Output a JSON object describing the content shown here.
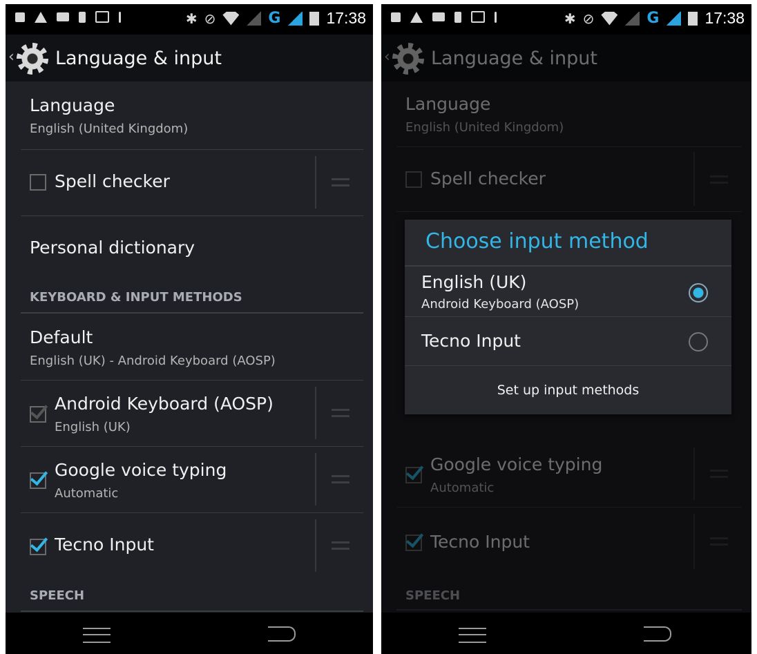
{
  "status_bar": {
    "time": "17:38",
    "network": "G"
  },
  "action_bar": {
    "title": "Language & input"
  },
  "settings": {
    "language_title": "Language",
    "language_value": "English (United Kingdom)",
    "spell_checker": "Spell checker",
    "personal_dictionary": "Personal dictionary",
    "keyboard_section": "KEYBOARD & INPUT METHODS",
    "default_title": "Default",
    "default_value": "English (UK) - Android Keyboard (AOSP)",
    "aosp_title": "Android Keyboard (AOSP)",
    "aosp_sub": "English (UK)",
    "google_voice_title": "Google voice typing",
    "google_voice_sub": "Automatic",
    "tecno_title": "Tecno Input",
    "speech_section": "SPEECH"
  },
  "dialog": {
    "title": "Choose input method",
    "options": [
      {
        "label": "English (UK)",
        "sub": "Android Keyboard (AOSP)",
        "selected": true
      },
      {
        "label": "Tecno Input",
        "sub": "",
        "selected": false
      }
    ],
    "button": "Set up input methods"
  },
  "colors": {
    "accent": "#33b5e5",
    "background": "#1f2126",
    "actionbar": "#111215"
  }
}
